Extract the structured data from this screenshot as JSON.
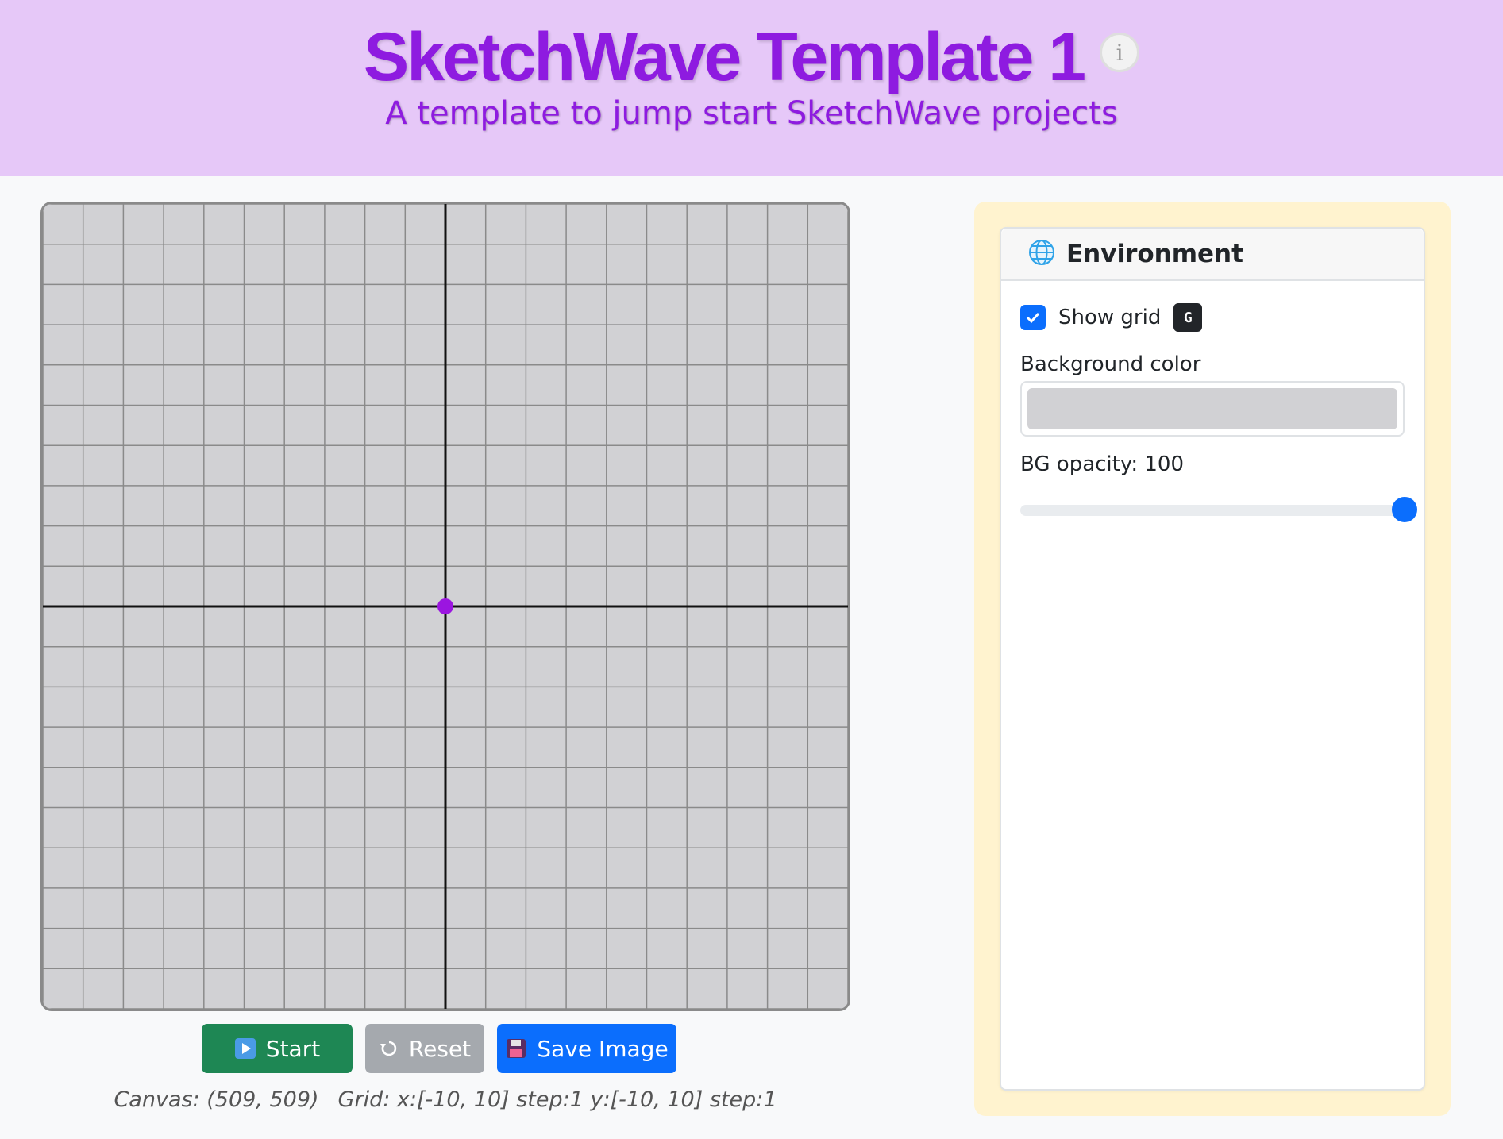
{
  "header": {
    "title": "SketchWave Template 1",
    "subtitle": "A template to jump start SketchWave projects",
    "info_icon": "info-circle-icon"
  },
  "canvas": {
    "background_color": "#d1d1d4",
    "grid": {
      "x_range": [
        -10,
        10
      ],
      "y_range": [
        -10,
        10
      ],
      "step": 1
    },
    "grid_line_color": "#8a8a8a",
    "axis_color": "#111111",
    "origin_point": {
      "x": 0,
      "y": 0,
      "color": "#9b15e0"
    }
  },
  "toolbar": {
    "start_label": "Start",
    "start_icon": "play-icon",
    "reset_label": "Reset",
    "reset_icon": "reset-icon",
    "save_label": "Save Image",
    "save_icon": "floppy-disk-icon"
  },
  "status": {
    "canvas_text": "Canvas: (509, 509)",
    "grid_text": "Grid: x:[-10, 10] step:1 y:[-10, 10] step:1"
  },
  "environment": {
    "title": "Environment",
    "icon": "globe-icon",
    "show_grid_label": "Show grid",
    "show_grid_checked": true,
    "show_grid_shortcut": "G",
    "background_color_label": "Background color",
    "background_color_value": "#d1d1d4",
    "bg_opacity_label": "BG opacity: 100",
    "bg_opacity_value": 100
  }
}
